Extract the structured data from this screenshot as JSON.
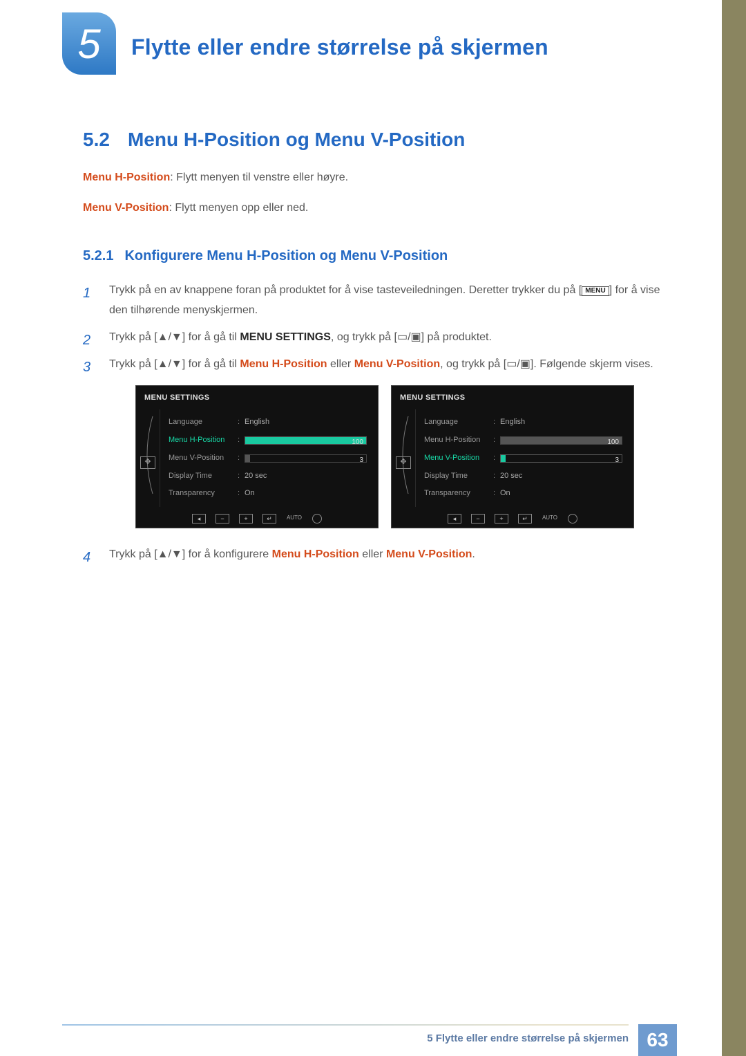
{
  "chapter": {
    "number": "5",
    "title": "Flytte eller endre størrelse på skjermen"
  },
  "section": {
    "number": "5.2",
    "title": "Menu H-Position og Menu V-Position"
  },
  "desc_h": {
    "term": "Menu H-Position",
    "text": ": Flytt menyen til venstre eller høyre."
  },
  "desc_v": {
    "term": "Menu V-Position",
    "text": ": Flytt menyen opp eller ned."
  },
  "subsection": {
    "number": "5.2.1",
    "title": "Konfigurere Menu H-Position og Menu V-Position"
  },
  "steps": {
    "s1": {
      "n": "1",
      "a": "Trykk på en av knappene foran på produktet for å vise tasteveiledningen. Deretter trykker du på [",
      "menu": "MENU",
      "b": "] for å vise den tilhørende menyskjermen."
    },
    "s2": {
      "n": "2",
      "a": "Trykk på [",
      "b": "] for å gå til ",
      "bold": "MENU SETTINGS",
      "c": ", og trykk på [",
      "d": "] på produktet."
    },
    "s3": {
      "n": "3",
      "a": "Trykk på [",
      "b": "] for å gå til ",
      "t1": "Menu H-Position",
      "mid": " eller ",
      "t2": "Menu V-Position",
      "c": ", og trykk på [",
      "d": "]. Følgende skjerm vises."
    },
    "s4": {
      "n": "4",
      "a": "Trykk på [",
      "b": "] for å konfigurere ",
      "t1": "Menu H-Position",
      "mid": " eller ",
      "t2": "Menu V-Position",
      "end": "."
    }
  },
  "osd": {
    "title": "MENU SETTINGS",
    "items": {
      "language": {
        "label": "Language",
        "value": "English"
      },
      "hpos": {
        "label": "Menu H-Position",
        "value": "100",
        "fill": "100%"
      },
      "vpos": {
        "label": "Menu V-Position",
        "value": "3",
        "fill": "4%"
      },
      "dtime": {
        "label": "Display Time",
        "value": "20 sec"
      },
      "trans": {
        "label": "Transparency",
        "value": "On"
      }
    },
    "auto": "AUTO"
  },
  "footer": {
    "text": "5 Flytte eller endre størrelse på skjermen",
    "page": "63"
  }
}
